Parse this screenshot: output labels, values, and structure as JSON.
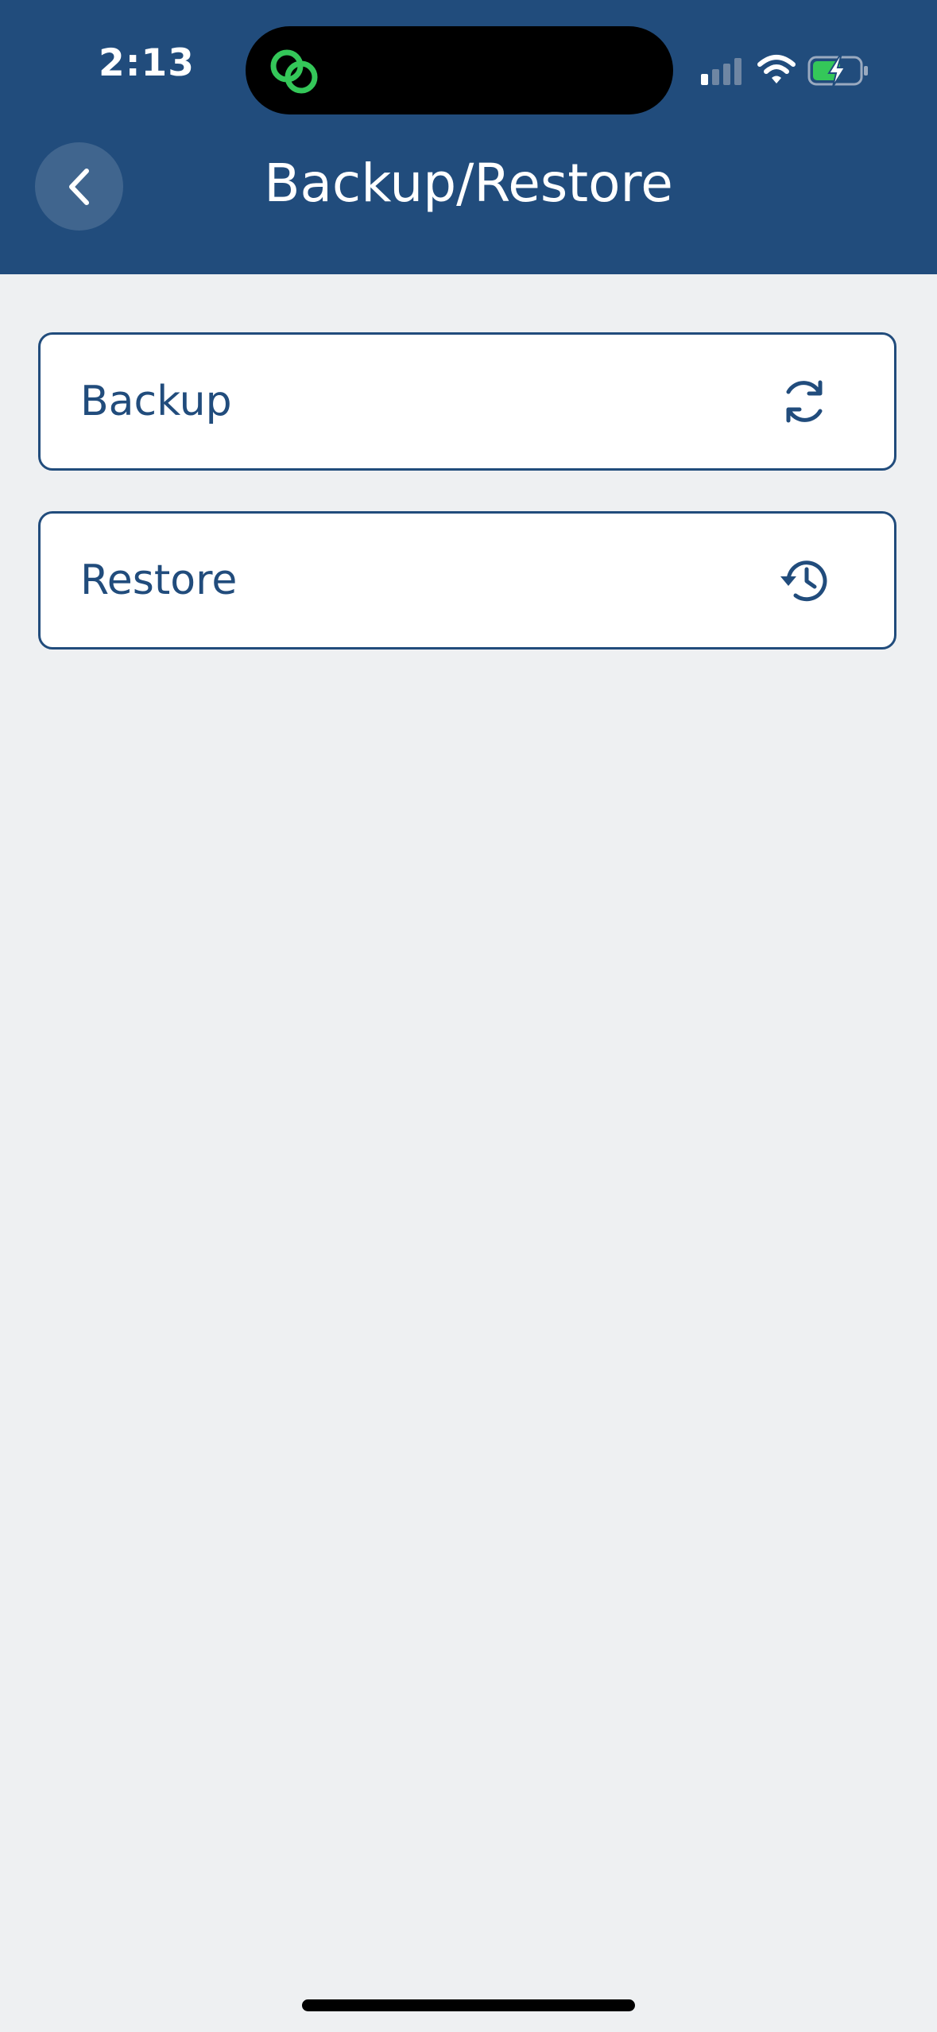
{
  "status_bar": {
    "time": "2:13"
  },
  "header": {
    "title": "Backup/Restore"
  },
  "options": [
    {
      "label": "Backup",
      "icon": "sync-icon"
    },
    {
      "label": "Restore",
      "icon": "history-icon"
    }
  ],
  "colors": {
    "primary": "#214C7C",
    "background": "#EEF0F2",
    "card": "#FFFFFF",
    "island_accent": "#34C759"
  }
}
